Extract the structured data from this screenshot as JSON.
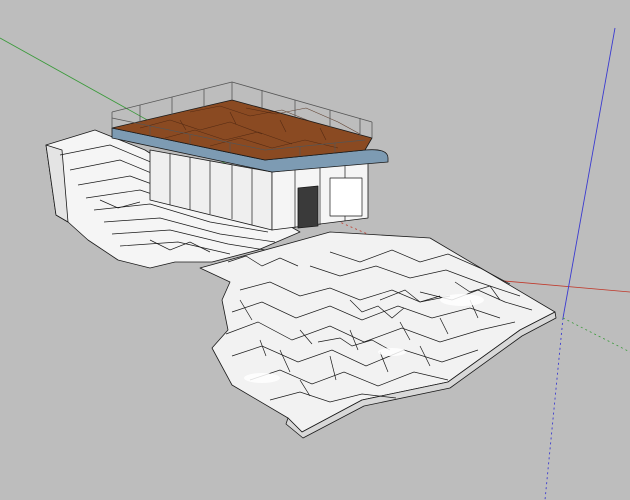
{
  "viewport": {
    "background": "#bdbdbd",
    "axis_colors": {
      "green": "#3a9a3a",
      "red": "#c0392b",
      "blue": "#3b3bd0"
    }
  },
  "model": {
    "roof_color": "#8a4a22",
    "roof_rim_color": "#7d9bb3",
    "surface_color": "#f4f4f4",
    "edge_color": "#1a1a1a"
  }
}
